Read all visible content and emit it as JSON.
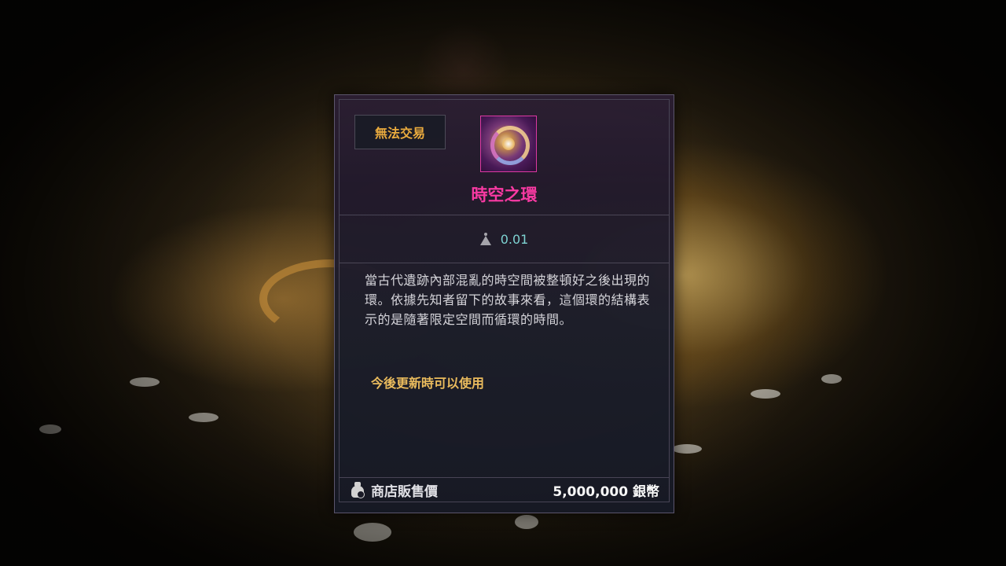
{
  "tooltip": {
    "trade_status": "無法交易",
    "item_icon": "time-space-ring-icon",
    "item_name": "時空之環",
    "item_name_color": "#ff3aa8",
    "weight_icon": "weight-icon",
    "weight": "0.01",
    "description": "當古代遺跡內部混亂的時空間被整頓好之後出現的環。依據先知者留下的故事來看，這個環的結構表示的是隨著限定空間而循環的時間。",
    "usage_note": "今後更新時可以使用",
    "shop_price_icon": "money-bag-icon",
    "shop_price_label": "商店販售價",
    "shop_price_value": "5,000,000 銀幣"
  }
}
